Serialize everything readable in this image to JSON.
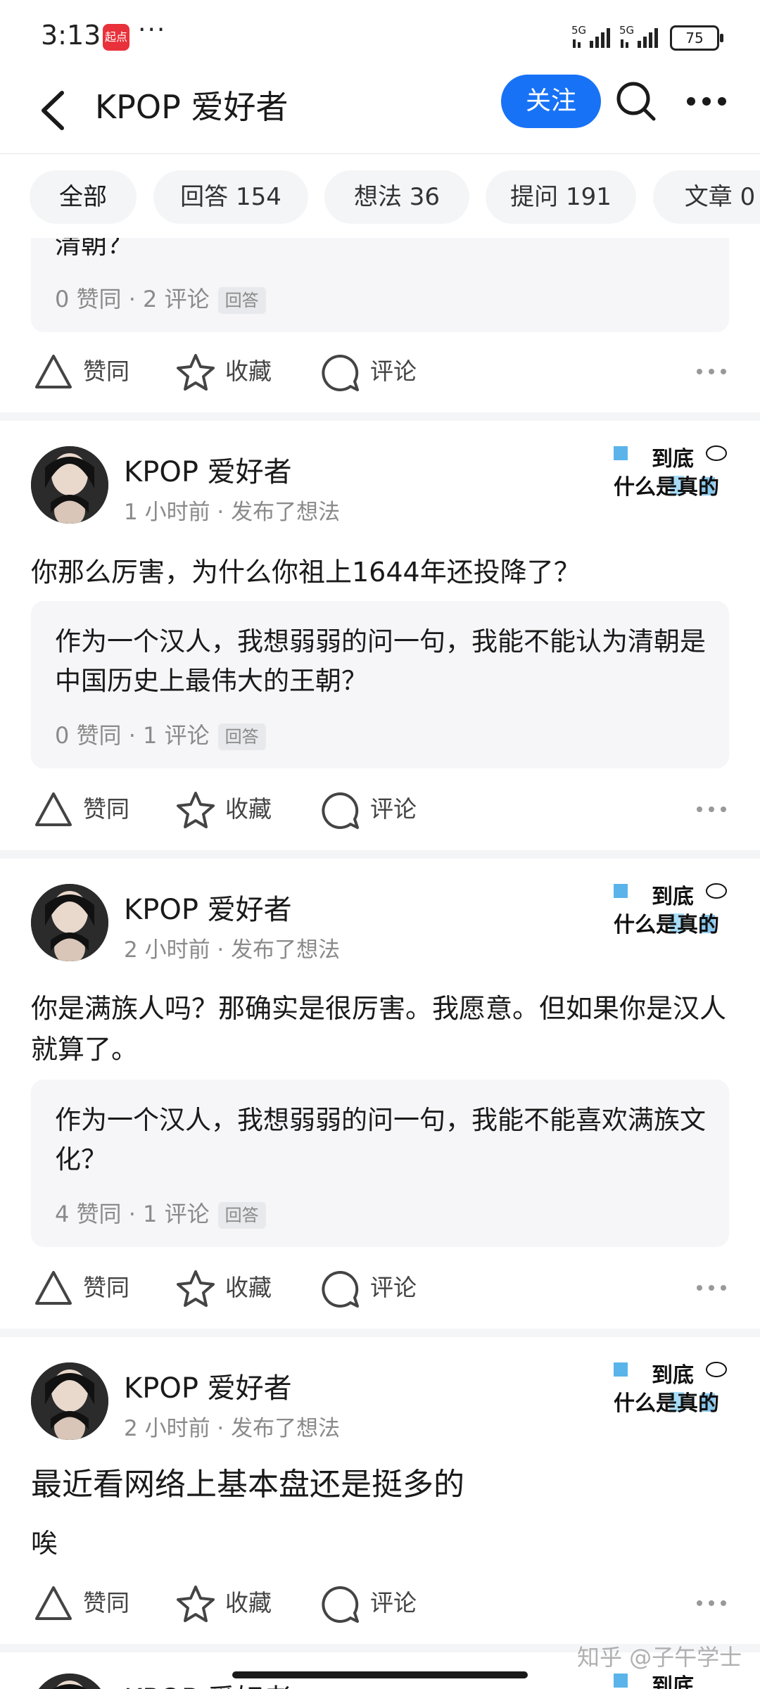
{
  "status_bar": {
    "time": "3:13",
    "app_badge": "起点",
    "more": "···",
    "signal_1": "5G",
    "signal_2": "5G",
    "battery": "75"
  },
  "header": {
    "title": "KPOP 爱好者",
    "follow_label": "关注"
  },
  "tabs": [
    {
      "label": "全部"
    },
    {
      "label": "回答 154"
    },
    {
      "label": "想法 36"
    },
    {
      "label": "提问 191"
    },
    {
      "label": "文章 0"
    }
  ],
  "badge_text": {
    "line1": "到底",
    "line2": "什么是真的"
  },
  "actions": {
    "like": "赞同",
    "collect": "收藏",
    "comment": "评论"
  },
  "partial_post": {
    "quote_tail": "清朝？",
    "quote_stats": "0 赞同 · 2 评论",
    "quote_tag": "回答"
  },
  "posts": [
    {
      "author": "KPOP 爱好者",
      "meta": "1 小时前 · 发布了想法",
      "content": "你那么厉害，为什么你祖上1644年还投降了？",
      "quote_text": "作为一个汉人，我想弱弱的问一句，我能不能认为清朝是中国历史上最伟大的王朝？",
      "quote_stats": "0 赞同 · 1 评论",
      "quote_tag": "回答"
    },
    {
      "author": "KPOP 爱好者",
      "meta": "2 小时前 · 发布了想法",
      "content": "你是满族人吗？那确实是很厉害。我愿意。但如果你是汉人就算了。",
      "quote_text": "作为一个汉人，我想弱弱的问一句，我能不能喜欢满族文化？",
      "quote_stats": "4 赞同 · 1 评论",
      "quote_tag": "回答"
    },
    {
      "author": "KPOP 爱好者",
      "meta": "2 小时前 · 发布了想法",
      "title": "最近看网络上基本盘还是挺多的",
      "content": "唉"
    },
    {
      "author": "KPOP 爱好者"
    }
  ],
  "watermark": "知乎 @子午学士"
}
